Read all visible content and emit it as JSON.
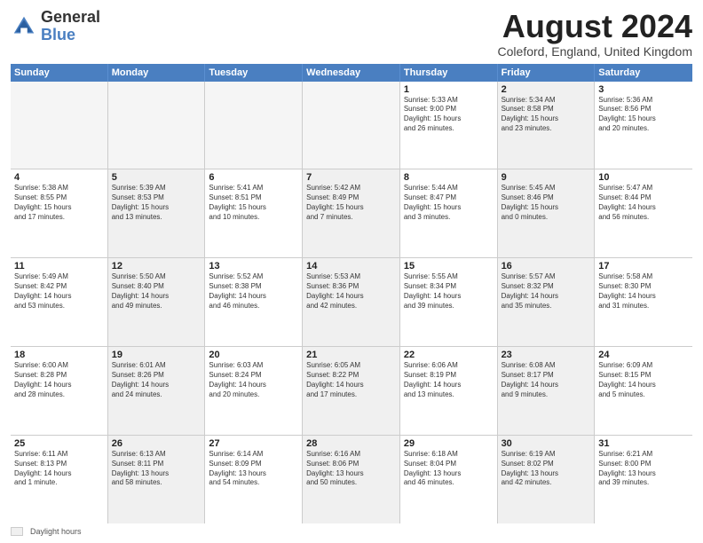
{
  "header": {
    "logo_general": "General",
    "logo_blue": "Blue",
    "month_title": "August 2024",
    "location": "Coleford, England, United Kingdom"
  },
  "days_of_week": [
    "Sunday",
    "Monday",
    "Tuesday",
    "Wednesday",
    "Thursday",
    "Friday",
    "Saturday"
  ],
  "weeks": [
    [
      {
        "date": "",
        "info": "",
        "empty": true
      },
      {
        "date": "",
        "info": "",
        "empty": true
      },
      {
        "date": "",
        "info": "",
        "empty": true
      },
      {
        "date": "",
        "info": "",
        "empty": true
      },
      {
        "date": "1",
        "info": "Sunrise: 5:33 AM\nSunset: 9:00 PM\nDaylight: 15 hours\nand 26 minutes.",
        "shade": false
      },
      {
        "date": "2",
        "info": "Sunrise: 5:34 AM\nSunset: 8:58 PM\nDaylight: 15 hours\nand 23 minutes.",
        "shade": true
      },
      {
        "date": "3",
        "info": "Sunrise: 5:36 AM\nSunset: 8:56 PM\nDaylight: 15 hours\nand 20 minutes.",
        "shade": false
      }
    ],
    [
      {
        "date": "4",
        "info": "Sunrise: 5:38 AM\nSunset: 8:55 PM\nDaylight: 15 hours\nand 17 minutes.",
        "shade": false
      },
      {
        "date": "5",
        "info": "Sunrise: 5:39 AM\nSunset: 8:53 PM\nDaylight: 15 hours\nand 13 minutes.",
        "shade": true
      },
      {
        "date": "6",
        "info": "Sunrise: 5:41 AM\nSunset: 8:51 PM\nDaylight: 15 hours\nand 10 minutes.",
        "shade": false
      },
      {
        "date": "7",
        "info": "Sunrise: 5:42 AM\nSunset: 8:49 PM\nDaylight: 15 hours\nand 7 minutes.",
        "shade": true
      },
      {
        "date": "8",
        "info": "Sunrise: 5:44 AM\nSunset: 8:47 PM\nDaylight: 15 hours\nand 3 minutes.",
        "shade": false
      },
      {
        "date": "9",
        "info": "Sunrise: 5:45 AM\nSunset: 8:46 PM\nDaylight: 15 hours\nand 0 minutes.",
        "shade": true
      },
      {
        "date": "10",
        "info": "Sunrise: 5:47 AM\nSunset: 8:44 PM\nDaylight: 14 hours\nand 56 minutes.",
        "shade": false
      }
    ],
    [
      {
        "date": "11",
        "info": "Sunrise: 5:49 AM\nSunset: 8:42 PM\nDaylight: 14 hours\nand 53 minutes.",
        "shade": false
      },
      {
        "date": "12",
        "info": "Sunrise: 5:50 AM\nSunset: 8:40 PM\nDaylight: 14 hours\nand 49 minutes.",
        "shade": true
      },
      {
        "date": "13",
        "info": "Sunrise: 5:52 AM\nSunset: 8:38 PM\nDaylight: 14 hours\nand 46 minutes.",
        "shade": false
      },
      {
        "date": "14",
        "info": "Sunrise: 5:53 AM\nSunset: 8:36 PM\nDaylight: 14 hours\nand 42 minutes.",
        "shade": true
      },
      {
        "date": "15",
        "info": "Sunrise: 5:55 AM\nSunset: 8:34 PM\nDaylight: 14 hours\nand 39 minutes.",
        "shade": false
      },
      {
        "date": "16",
        "info": "Sunrise: 5:57 AM\nSunset: 8:32 PM\nDaylight: 14 hours\nand 35 minutes.",
        "shade": true
      },
      {
        "date": "17",
        "info": "Sunrise: 5:58 AM\nSunset: 8:30 PM\nDaylight: 14 hours\nand 31 minutes.",
        "shade": false
      }
    ],
    [
      {
        "date": "18",
        "info": "Sunrise: 6:00 AM\nSunset: 8:28 PM\nDaylight: 14 hours\nand 28 minutes.",
        "shade": false
      },
      {
        "date": "19",
        "info": "Sunrise: 6:01 AM\nSunset: 8:26 PM\nDaylight: 14 hours\nand 24 minutes.",
        "shade": true
      },
      {
        "date": "20",
        "info": "Sunrise: 6:03 AM\nSunset: 8:24 PM\nDaylight: 14 hours\nand 20 minutes.",
        "shade": false
      },
      {
        "date": "21",
        "info": "Sunrise: 6:05 AM\nSunset: 8:22 PM\nDaylight: 14 hours\nand 17 minutes.",
        "shade": true
      },
      {
        "date": "22",
        "info": "Sunrise: 6:06 AM\nSunset: 8:19 PM\nDaylight: 14 hours\nand 13 minutes.",
        "shade": false
      },
      {
        "date": "23",
        "info": "Sunrise: 6:08 AM\nSunset: 8:17 PM\nDaylight: 14 hours\nand 9 minutes.",
        "shade": true
      },
      {
        "date": "24",
        "info": "Sunrise: 6:09 AM\nSunset: 8:15 PM\nDaylight: 14 hours\nand 5 minutes.",
        "shade": false
      }
    ],
    [
      {
        "date": "25",
        "info": "Sunrise: 6:11 AM\nSunset: 8:13 PM\nDaylight: 14 hours\nand 1 minute.",
        "shade": false
      },
      {
        "date": "26",
        "info": "Sunrise: 6:13 AM\nSunset: 8:11 PM\nDaylight: 13 hours\nand 58 minutes.",
        "shade": true
      },
      {
        "date": "27",
        "info": "Sunrise: 6:14 AM\nSunset: 8:09 PM\nDaylight: 13 hours\nand 54 minutes.",
        "shade": false
      },
      {
        "date": "28",
        "info": "Sunrise: 6:16 AM\nSunset: 8:06 PM\nDaylight: 13 hours\nand 50 minutes.",
        "shade": true
      },
      {
        "date": "29",
        "info": "Sunrise: 6:18 AM\nSunset: 8:04 PM\nDaylight: 13 hours\nand 46 minutes.",
        "shade": false
      },
      {
        "date": "30",
        "info": "Sunrise: 6:19 AM\nSunset: 8:02 PM\nDaylight: 13 hours\nand 42 minutes.",
        "shade": true
      },
      {
        "date": "31",
        "info": "Sunrise: 6:21 AM\nSunset: 8:00 PM\nDaylight: 13 hours\nand 39 minutes.",
        "shade": false
      }
    ]
  ],
  "footer": {
    "legend_label": "Daylight hours"
  }
}
